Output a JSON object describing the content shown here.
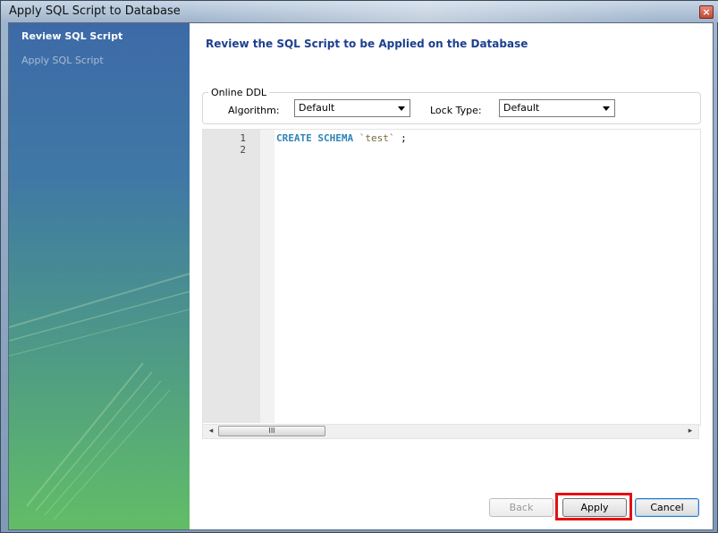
{
  "window": {
    "title": "Apply SQL Script to Database",
    "close_label": "×"
  },
  "sidebar": {
    "items": [
      {
        "label": "Review SQL Script",
        "active": true
      },
      {
        "label": "Apply SQL Script",
        "active": false
      }
    ]
  },
  "main": {
    "heading": "Review the SQL Script to be Applied on the Database",
    "online_ddl": {
      "legend": "Online DDL",
      "algorithm_label": "Algorithm:",
      "algorithm_value": "Default",
      "lock_type_label": "Lock Type:",
      "lock_type_value": "Default"
    },
    "editor": {
      "line_numbers": [
        "1",
        "2"
      ],
      "code": {
        "keyword": "CREATE SCHEMA",
        "identifier": "`test`",
        "terminator": ";"
      }
    },
    "scrollbar": {
      "left_arrow": "◂",
      "right_arrow": "▸",
      "thumb_grip": "III"
    }
  },
  "buttons": {
    "back": "Back",
    "apply": "Apply",
    "cancel": "Cancel"
  },
  "colors": {
    "heading": "#1d3f8f",
    "keyword": "#2f84b8",
    "highlight": "#e51010"
  }
}
